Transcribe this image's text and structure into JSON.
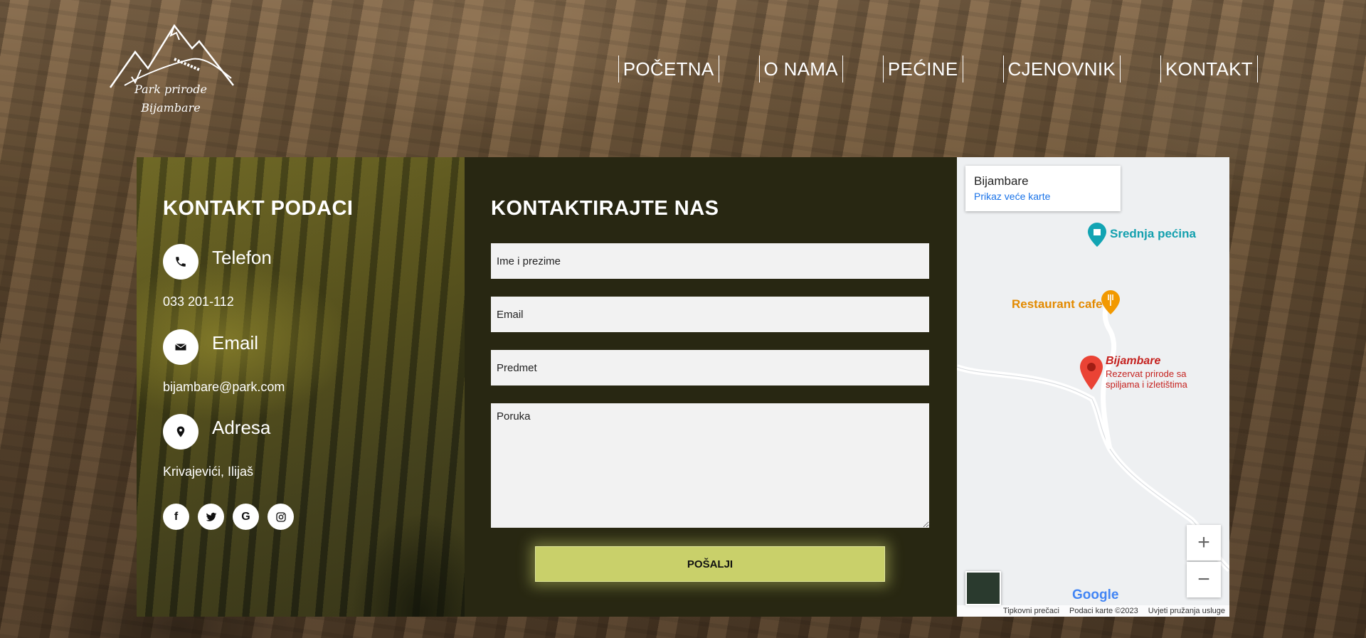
{
  "logo": {
    "line1": "Park prirode",
    "line2": "Bijambare"
  },
  "nav": [
    "POČETNA",
    "O NAMA",
    "PEĆINE",
    "CJENOVNIK",
    "KONTAKT"
  ],
  "contact_info": {
    "title": "KONTAKT PODACI",
    "phone": {
      "label": "Telefon",
      "value": "033 201-112",
      "icon": "phone-icon"
    },
    "email": {
      "label": "Email",
      "value": "bijambare@park.com",
      "icon": "envelope-icon"
    },
    "address": {
      "label": "Adresa",
      "value": "Krivajevići, Ilijaš",
      "icon": "map-pin-icon"
    },
    "social": [
      "facebook-icon",
      "twitter-icon",
      "google-icon",
      "instagram-icon"
    ]
  },
  "form": {
    "title": "KONTAKTIRAJTE NAS",
    "name_placeholder": "Ime i prezime",
    "email_placeholder": "Email",
    "subject_placeholder": "Predmet",
    "message_placeholder": "Poruka",
    "submit_label": "POŠALJI",
    "accent": "#c9d06a"
  },
  "map": {
    "place_name": "Bijambare",
    "larger_map_link": "Prikaz veće karte",
    "poi_cave": "Srednja pećina",
    "poi_restaurant": "Restaurant cafe",
    "pin_title": "Bijambare",
    "pin_subtitle_1": "Rezervat prirode sa",
    "pin_subtitle_2": "spiljama i izletištima",
    "google": "Google",
    "footer_shortcuts": "Tipkovni prečaci",
    "footer_data": "Podaci karte ©2023",
    "footer_terms": "Uvjeti pružanja usluge",
    "zoom_in": "+",
    "zoom_out": "−"
  }
}
